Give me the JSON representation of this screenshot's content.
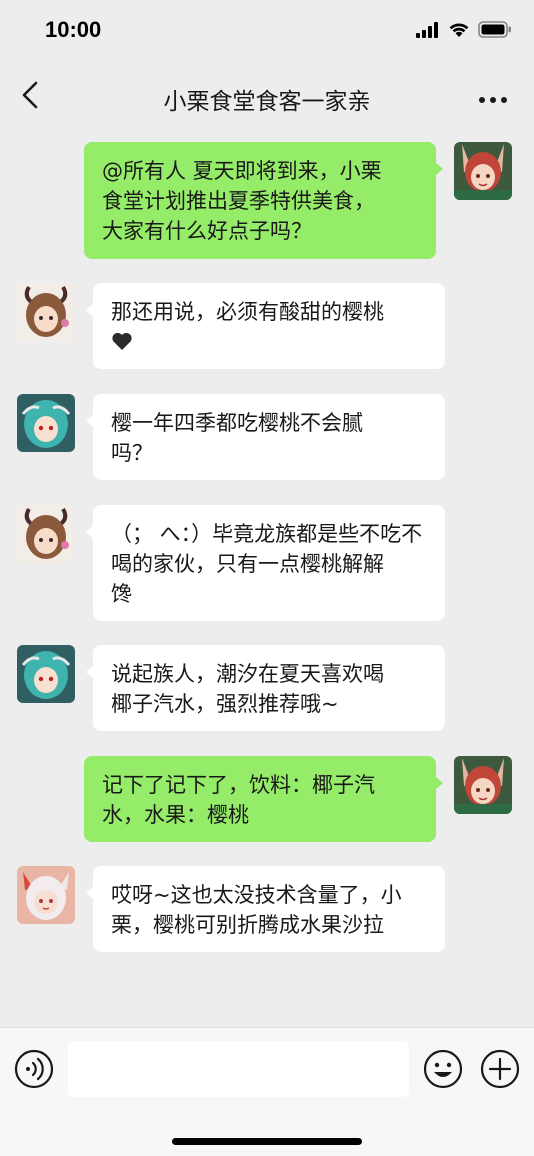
{
  "status_bar": {
    "time": "10:00",
    "icons": [
      "signal-icon",
      "wifi-icon",
      "battery-icon"
    ]
  },
  "header": {
    "title": "小栗食堂食客一家亲",
    "back_icon": "chevron-left-icon",
    "more_icon": "more-icon"
  },
  "messages": [
    {
      "side": "right",
      "sender_avatar": "fox-ears-girl-avatar",
      "lines": [
        "@所有人 夏天即将到来，小栗",
        "食堂计划推出夏季特供美食，",
        "大家有什么好点子吗？"
      ]
    },
    {
      "side": "left",
      "sender_avatar": "horned-girl-avatar",
      "lines": [
        "那还用说，必须有酸甜的樱桃"
      ],
      "trailing_icon": "heart-icon"
    },
    {
      "side": "left",
      "sender_avatar": "teal-hair-girl-avatar",
      "lines": [
        "樱一年四季都吃樱桃不会腻",
        "吗？"
      ]
    },
    {
      "side": "left",
      "sender_avatar": "horned-girl-avatar",
      "lines": [
        "（； へ：）毕竟龙族都是些不吃不",
        "喝的家伙，只有一点樱桃解解",
        "馋"
      ]
    },
    {
      "side": "left",
      "sender_avatar": "teal-hair-girl-avatar",
      "lines": [
        "说起族人，潮汐在夏天喜欢喝",
        "椰子汽水，强烈推荐哦~"
      ]
    },
    {
      "side": "right",
      "sender_avatar": "fox-ears-girl-avatar",
      "lines": [
        "记下了记下了，饮料：椰子汽",
        "水，水果：樱桃"
      ]
    },
    {
      "side": "left",
      "sender_avatar": "white-hair-girl-avatar",
      "lines": [
        "哎呀~这也太没技术含量了，小",
        "栗，樱桃可别折腾成水果沙拉"
      ]
    }
  ],
  "input_bar": {
    "voice_icon": "voice-icon",
    "emoji_icon": "emoji-icon",
    "plus_icon": "plus-icon",
    "input_value": ""
  }
}
